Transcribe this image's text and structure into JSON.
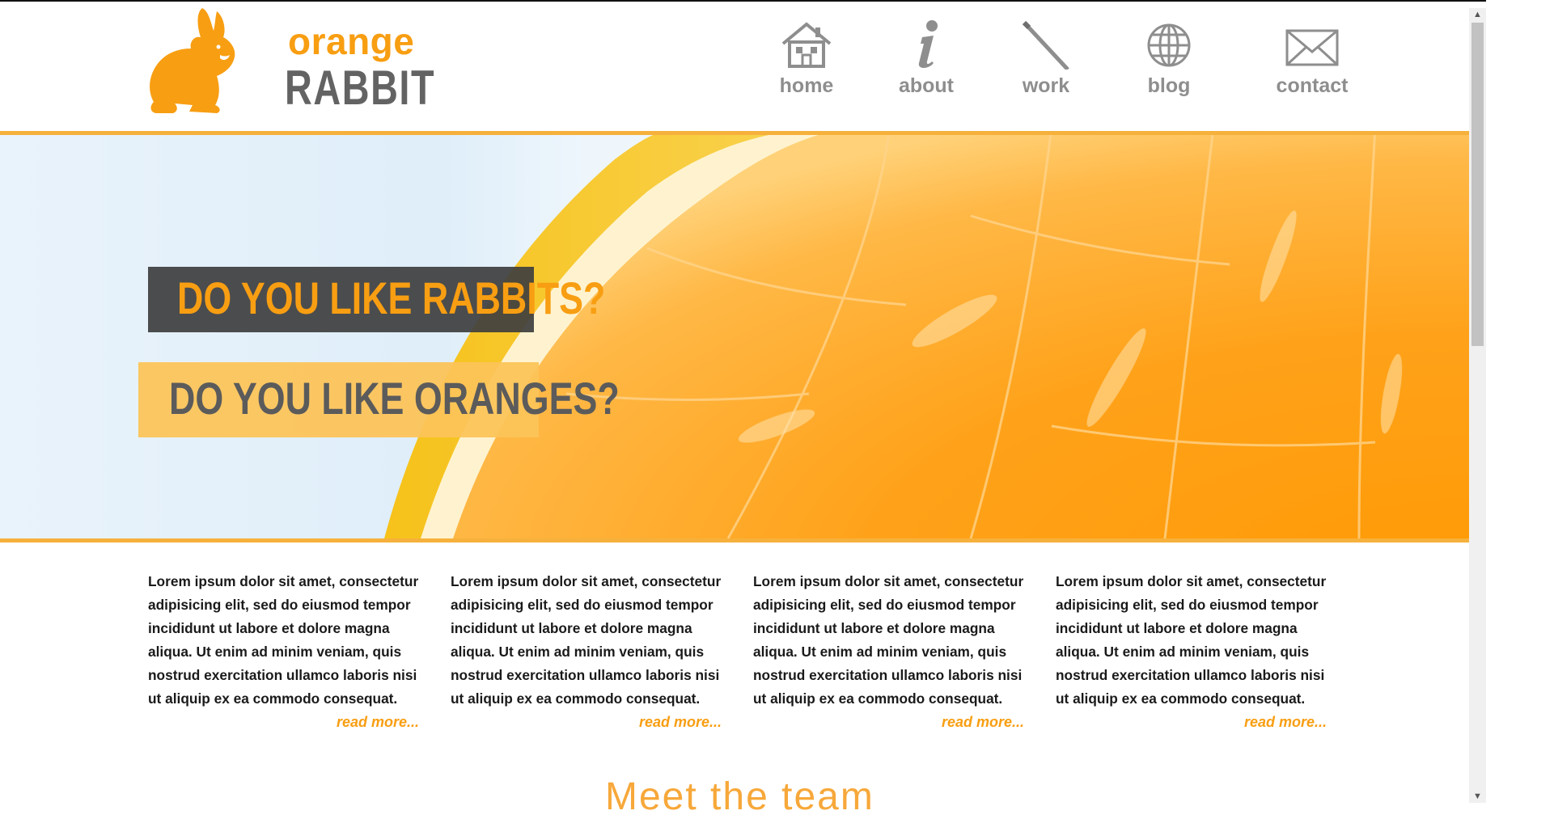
{
  "logo": {
    "top": "orange",
    "bottom": "RABBIT"
  },
  "nav": [
    {
      "label": "home",
      "icon": "house-icon"
    },
    {
      "label": "about",
      "icon": "info-icon"
    },
    {
      "label": "work",
      "icon": "pen-icon"
    },
    {
      "label": "blog",
      "icon": "globe-icon"
    },
    {
      "label": "contact",
      "icon": "envelope-icon"
    }
  ],
  "hero": {
    "line1": "DO YOU LIKE RABBITS?",
    "line2": "DO YOU LIKE ORANGES?"
  },
  "columns": [
    {
      "text": "Lorem ipsum dolor sit amet, consectetur adipisicing elit, sed do eiusmod tempor incididunt ut labore et dolore magna aliqua. Ut enim ad minim veniam, quis nostrud exercitation ullamco laboris nisi ut aliquip ex ea commodo consequat.",
      "more": "read more..."
    },
    {
      "text": "Lorem ipsum dolor sit amet, consectetur adipisicing elit, sed do eiusmod tempor incididunt ut labore et dolore magna aliqua. Ut enim ad minim veniam, quis nostrud exercitation ullamco laboris nisi ut aliquip ex ea commodo consequat.",
      "more": "read more..."
    },
    {
      "text": "Lorem ipsum dolor sit amet, consectetur adipisicing elit, sed do eiusmod tempor incididunt ut labore et dolore magna aliqua. Ut enim ad minim veniam, quis nostrud exercitation ullamco laboris nisi ut aliquip ex ea commodo consequat.",
      "more": "read more..."
    },
    {
      "text": "Lorem ipsum dolor sit amet, consectetur adipisicing elit, sed do eiusmod tempor incididunt ut labore et dolore magna aliqua. Ut enim ad minim veniam, quis nostrud exercitation ullamco laboris nisi ut aliquip ex ea commodo consequat.",
      "more": "read more..."
    }
  ],
  "team_title": "Meet the team",
  "colors": {
    "accent": "#f89e12",
    "divider": "#f6b13c",
    "nav_text": "#8e8e8e"
  }
}
